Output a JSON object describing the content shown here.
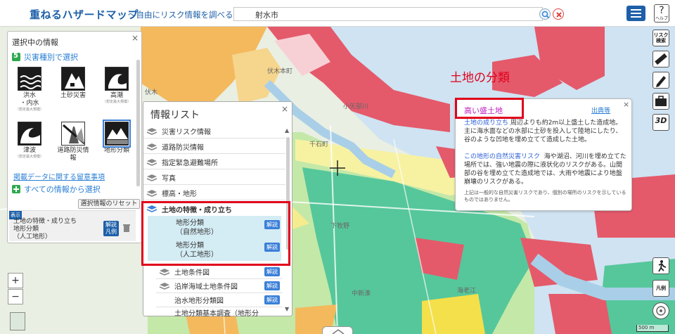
{
  "header": {
    "app_title": "重ねるハザードマップ",
    "app_subtitle": "～自由にリスク情報を調べる～",
    "search_value": "射水市",
    "help_label": "ヘルプ"
  },
  "map": {
    "labels": [
      "伏木本町",
      "伏木",
      "小矢部川",
      "千石町",
      "下牧野",
      "中新湊",
      "海老江"
    ]
  },
  "annotation": "土地の分類",
  "left_panel": {
    "title": "選択中の情報",
    "hazard_section": "災害種別で選択",
    "hazards": [
      {
        "label": "洪水\n・内水",
        "sub": "（想定最大規模）"
      },
      {
        "label": "土砂災害",
        "sub": ""
      },
      {
        "label": "高潮",
        "sub": "（想定最大規模）"
      },
      {
        "label": "津波",
        "sub": "（想定最大規模）"
      },
      {
        "label": "道路防災情報",
        "sub": ""
      },
      {
        "label": "地形分類",
        "sub": ""
      }
    ],
    "notice_link": "掲載データに関する留意事項",
    "all_info": "すべての情報から選択",
    "reset_button": "選択情報のリセット",
    "display_badge": "表示",
    "selected_text": "土地の特徴・成り立ち\n地形分類\n（人工地形）",
    "legend_button": "解説\n凡例"
  },
  "info_panel": {
    "title": "情報リスト",
    "items": [
      "災害リスク情報",
      "道路防災情報",
      "指定緊急避難場所",
      "写真",
      "標高・地形",
      "土地の特徴・成り立ち"
    ],
    "sub_items": [
      "地形分類\n（自然地形）",
      "地形分類\n（人工地形）"
    ],
    "more_items": [
      "土地条件図",
      "沿岸海域土地条件図",
      "治水地形分類図",
      "土地分類基本調査（地形分"
    ],
    "kaisetsu": "解説"
  },
  "popup": {
    "title": "高い盛土地",
    "source_link": "出典等",
    "para1_lead": "土地の成り立ち",
    "para1": "周辺よりも約2m以上盛土した造成地。主に海水面などの水部に土砂を投入して陸地にしたり、谷のような凹地を埋め立てて造成した土地。",
    "para2_lead": "この地形の自然災害リスク",
    "para2": "海や湖沼、河川を埋め立てた場所では、強い地震の際に液状化のリスクがある。山間部の谷を埋め立てた造成地では、大雨や地震により地盤崩壊のリスクがある。",
    "note": "上記は一般的な自然災害リスクであり、個別の場所のリスクを示しているものではありません。"
  },
  "toolbar": {
    "risk_search": "リスク\n検索",
    "legend": "凡例",
    "three_d": "3D",
    "scale": "500 m"
  },
  "colors": {
    "accent": "#1d5fa8",
    "highlight_red": "#e0001b",
    "link_blue": "#2a7fd4",
    "popup_title": "#c020c0"
  }
}
